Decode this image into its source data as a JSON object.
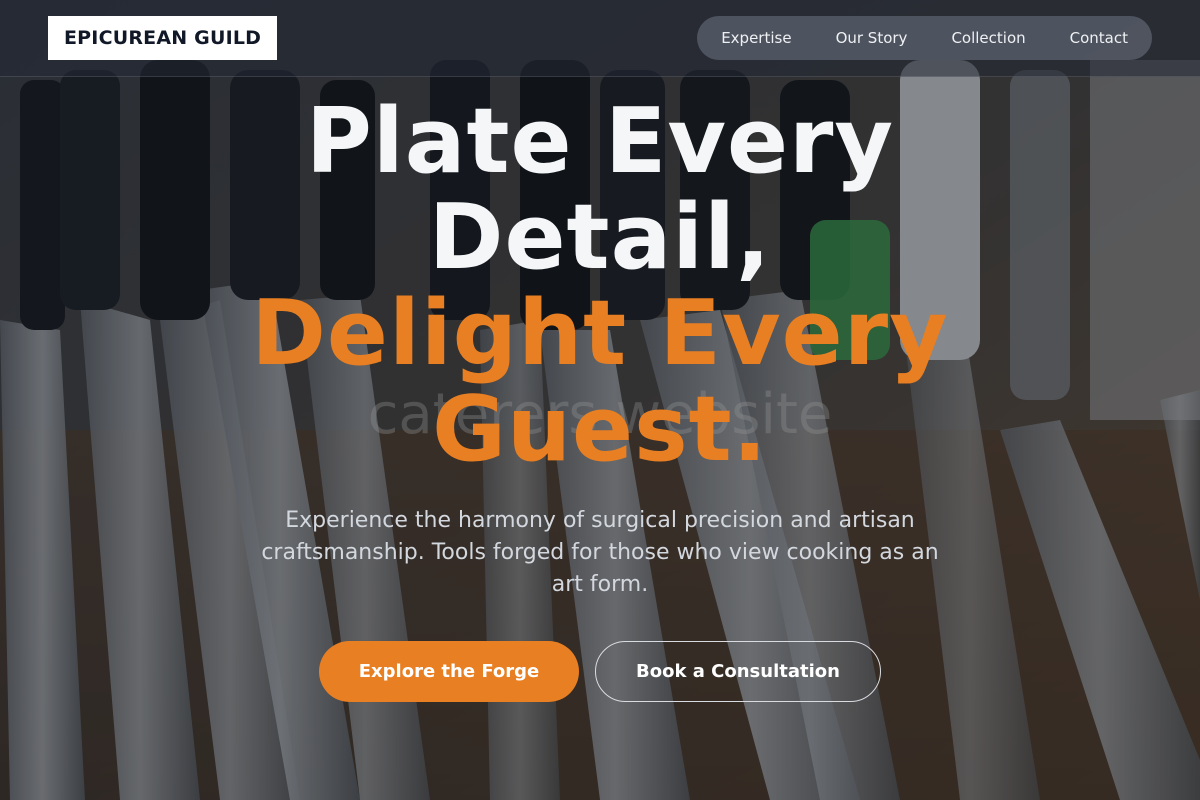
{
  "brand": {
    "logo_text": "EPICUREAN GUILD"
  },
  "nav": {
    "items": [
      {
        "label": "Expertise"
      },
      {
        "label": "Our Story"
      },
      {
        "label": "Collection"
      },
      {
        "label": "Contact"
      }
    ]
  },
  "hero": {
    "headline_line1": "Plate Every",
    "headline_line2": "Detail,",
    "headline_line3": "Delight Every",
    "headline_line4": "Guest.",
    "watermark": "caterers website",
    "subtitle": "Experience the harmony of surgical precision and artisan craftsmanship. Tools forged for those who view cooking as an art form.",
    "primary_cta": "Explore the Forge",
    "secondary_cta": "Book a Consultation",
    "background_image": "knife-rack-photo"
  },
  "colors": {
    "accent": "#e87f22",
    "headline_white": "#f4f6f8",
    "nav_bg": "rgba(34,40,52,0.55)"
  }
}
